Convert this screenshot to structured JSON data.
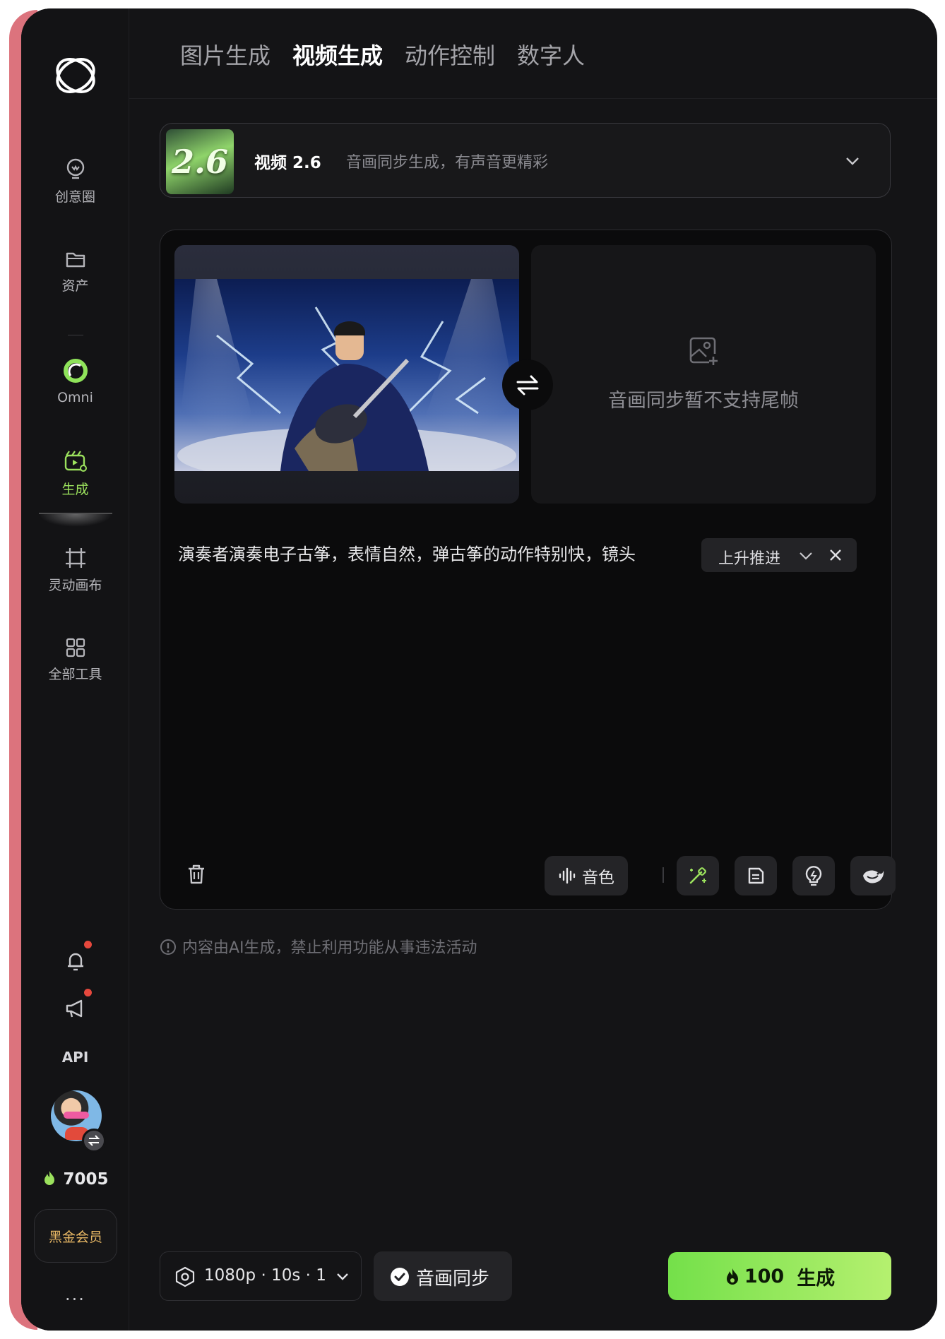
{
  "sidebar": {
    "items": [
      {
        "label": "创意圈",
        "icon": "lightbulb-icon"
      },
      {
        "label": "资产",
        "icon": "folder-icon"
      },
      {
        "label": "Omni",
        "icon": "omni-ring-icon"
      },
      {
        "label": "生成",
        "icon": "generate-clapper-icon"
      },
      {
        "label": "灵动画布",
        "icon": "canvas-icon"
      },
      {
        "label": "全部工具",
        "icon": "grid-icon"
      }
    ],
    "api_label": "API",
    "credits": "7005",
    "vip_label": "黑金会员",
    "more_label": "···"
  },
  "tabs": [
    {
      "label": "图片生成",
      "active": false
    },
    {
      "label": "视频生成",
      "active": true
    },
    {
      "label": "动作控制",
      "active": false
    },
    {
      "label": "数字人",
      "active": false
    }
  ],
  "model": {
    "thumb_text": "2.6",
    "name": "视频 2.6",
    "description": "音画同步生成，有声音更精彩"
  },
  "frames": {
    "end_frame_message": "音画同步暂不支持尾帧"
  },
  "prompt": {
    "text": "演奏者演奏电子古筝，表情自然，弹古筝的动作特别快，镜头",
    "camera_chip": "上升推进"
  },
  "toolbar": {
    "timbre_label": "音色"
  },
  "notice": "内容由AI生成，禁止利用功能从事违法活动",
  "footer": {
    "settings_label": "1080p · 10s · 1",
    "sync_label": "音画同步",
    "cost": "100",
    "generate_label": "生成"
  },
  "colors": {
    "accent_green": "#9be15d",
    "generate_gradient_start": "#74e04a",
    "generate_gradient_end": "#b5f06f",
    "background": "#141416",
    "vip_gold": "#e8b865",
    "notification_dot": "#e6483d"
  }
}
